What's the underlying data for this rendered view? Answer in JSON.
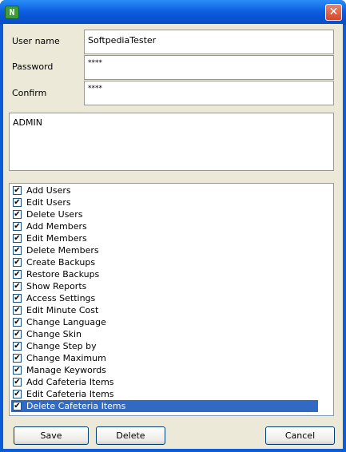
{
  "window": {
    "icon_text": "N",
    "close_glyph": "✕"
  },
  "form": {
    "username_label": "User name",
    "username_value": "SoftpediaTester",
    "password_label": "Password",
    "password_value": "****",
    "confirm_label": "Confirm",
    "confirm_value": "****",
    "role_text": "ADMIN"
  },
  "permissions": [
    {
      "label": "Add Users",
      "checked": true
    },
    {
      "label": "Edit Users",
      "checked": true
    },
    {
      "label": "Delete Users",
      "checked": true
    },
    {
      "label": "Add Members",
      "checked": true
    },
    {
      "label": "Edit Members",
      "checked": true
    },
    {
      "label": "Delete Members",
      "checked": true
    },
    {
      "label": "Create Backups",
      "checked": true
    },
    {
      "label": "Restore Backups",
      "checked": true
    },
    {
      "label": "Show Reports",
      "checked": true
    },
    {
      "label": "Access Settings",
      "checked": true
    },
    {
      "label": "Edit Minute Cost",
      "checked": true
    },
    {
      "label": "Change Language",
      "checked": true
    },
    {
      "label": "Change Skin",
      "checked": true
    },
    {
      "label": "Change Step by",
      "checked": true
    },
    {
      "label": "Change Maximum",
      "checked": true
    },
    {
      "label": "Manage Keywords",
      "checked": true
    },
    {
      "label": "Add Cafeteria Items",
      "checked": true
    },
    {
      "label": "Edit Cafeteria Items",
      "checked": true
    },
    {
      "label": "Delete Cafeteria Items",
      "checked": true,
      "selected": true
    }
  ],
  "buttons": {
    "save": "Save",
    "delete": "Delete",
    "cancel": "Cancel"
  },
  "colors": {
    "titlebar": "#0c5fe1",
    "selection": "#316ac5",
    "dialog_bg": "#ece9d8"
  }
}
